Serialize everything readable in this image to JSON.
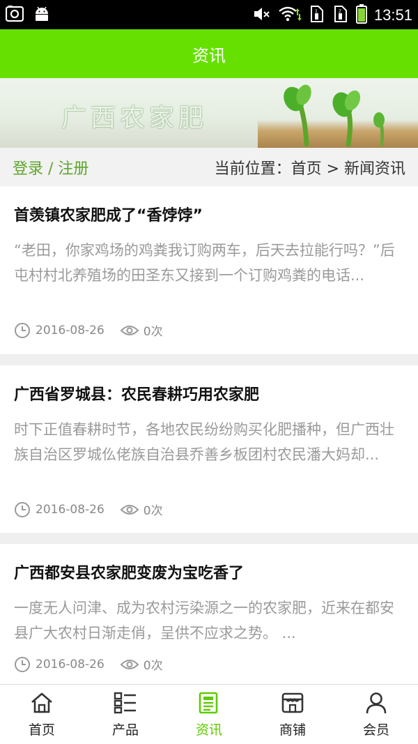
{
  "status_bar": {
    "time": "13:51"
  },
  "app_bar": {
    "title": "资讯"
  },
  "banner": {
    "text": "广西农家肥"
  },
  "breadcrumb_bar": {
    "login": "登录 / 注册",
    "location": "当前位置：首页 > 新闻资讯"
  },
  "articles": [
    {
      "title": "首羡镇农家肥成了“香饽饽”",
      "summary": "“老田，你家鸡场的鸡粪我订购两车，后天去拉能行吗？”后屯村村北养殖场的田圣东又接到一个订购鸡粪的电话...",
      "date": "2016-08-26",
      "views": "0次"
    },
    {
      "title": "广西省罗城县：农民春耕巧用农家肥",
      "summary": "时下正值春耕时节，各地农民纷纷购买化肥播种，但广西壮族自治区罗城仫佬族自治县乔善乡板团村农民潘大妈却...",
      "date": "2016-08-26",
      "views": "0次"
    },
    {
      "title": "广西都安县农家肥变废为宝吃香了",
      "summary": "一度无人问津、成为农村污染源之一的农家肥，近来在都安县广大农村日渐走俏，呈供不应求之势。 ...",
      "date": "2016-08-26",
      "views": "0次"
    }
  ],
  "tab_bar": {
    "items": [
      {
        "label": "首页",
        "icon": "home-icon"
      },
      {
        "label": "产品",
        "icon": "list-icon"
      },
      {
        "label": "资讯",
        "icon": "news-icon",
        "active": true
      },
      {
        "label": "商铺",
        "icon": "shop-icon"
      },
      {
        "label": "会员",
        "icon": "user-icon"
      }
    ]
  },
  "colors": {
    "accent": "#66e000",
    "link_green": "#5ea52c",
    "active_tab": "#5fcb00"
  }
}
